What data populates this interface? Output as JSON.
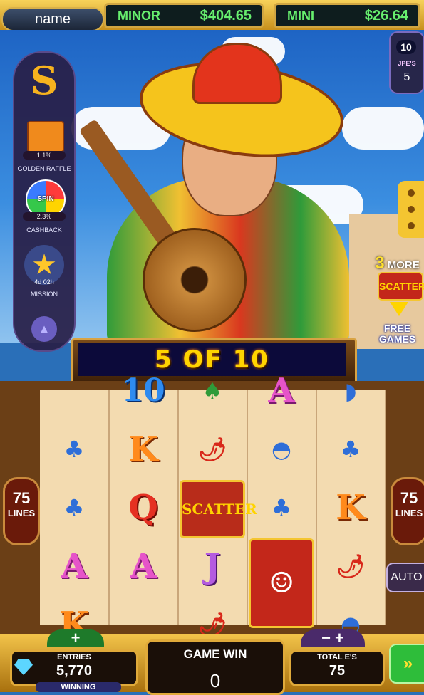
{
  "header": {
    "player_name": "name",
    "jackpots": [
      {
        "label": "MINOR",
        "value": "$404.65"
      },
      {
        "label": "MINI",
        "value": "$26.64"
      }
    ]
  },
  "side_panel": {
    "golden_raffle": {
      "label": "GOLDEN RAFFLE",
      "percent": "1.1%"
    },
    "cashback": {
      "label": "CASHBACK",
      "percent": "2.3%",
      "icon_text": "SPIN"
    },
    "mission": {
      "label": "MISSION",
      "timer": "4d 02h"
    }
  },
  "jpe": {
    "count": "10",
    "label": "JPE'S",
    "value": "5"
  },
  "free_games_hint": {
    "count": "3",
    "more": "MORE",
    "scatter": "SCATTER",
    "line1": "FREE",
    "line2": "GAMES"
  },
  "free_spins": {
    "text": "5 OF 10"
  },
  "reels": [
    [
      "",
      "maracas",
      "maracas",
      "A",
      "K"
    ],
    [
      "10",
      "K",
      "Q",
      "A",
      ""
    ],
    [
      "cactus",
      "chili",
      "SCATTER",
      "J",
      "chili"
    ],
    [
      "A",
      "sombrero",
      "maracas",
      "WILD",
      ""
    ],
    [
      "taco",
      "maracas",
      "K",
      "chili",
      "sombrero"
    ]
  ],
  "lines": {
    "left_count": "75",
    "right_count": "75",
    "label": "LINES"
  },
  "auto_label": "AUTO",
  "bottom": {
    "entries_label": "ENTRIES",
    "entries_value": "5,770",
    "winning_label": "WINNING",
    "game_win_label": "GAME WIN",
    "game_win_value": "0",
    "total_label": "TOTAL E'S",
    "total_value": "75"
  },
  "colors": {
    "accent_gold": "#f4c531",
    "banner_text": "#ffd400",
    "jackpot_green": "#67ef6e"
  }
}
